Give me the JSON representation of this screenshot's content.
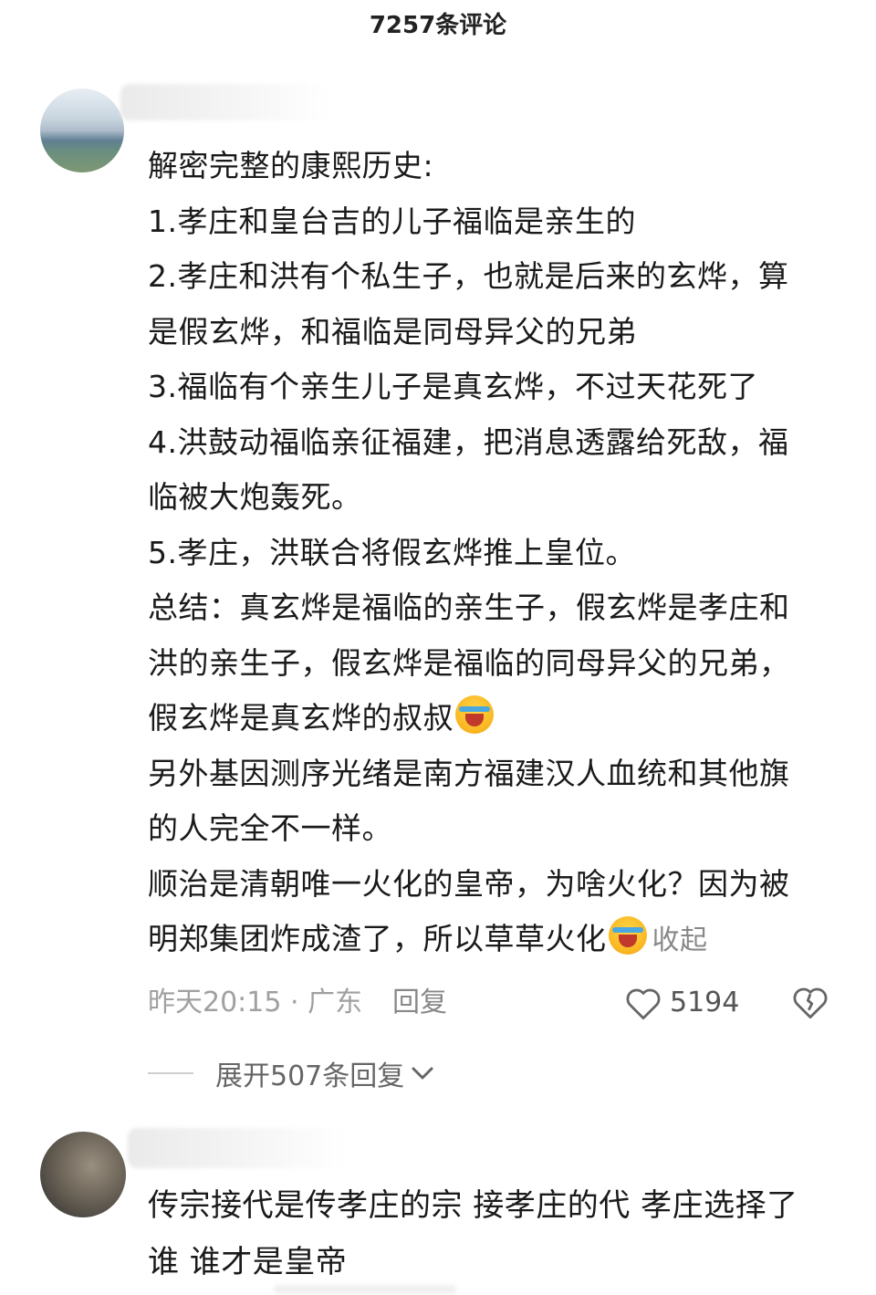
{
  "header": {
    "title": "7257条评论"
  },
  "comments": [
    {
      "lines": [
        "解密完整的康熙历史:",
        "1.孝庄和皇台吉的儿子福临是亲生的",
        "2.孝庄和洪有个私生子，也就是后来的玄烨，算",
        "是假玄烨，和福临是同母异父的兄弟",
        "3.福临有个亲生儿子是真玄烨，不过天花死了",
        "4.洪鼓动福临亲征福建，把消息透露给死敌，福",
        "临被大炮轰死。",
        "5.孝庄，洪联合将假玄烨推上皇位。",
        "总结：真玄烨是福临的亲生子，假玄烨是孝庄和",
        "洪的亲生子，假玄烨是福临的同母异父的兄弟，",
        "假玄烨是真玄烨的叔叔",
        "另外基因测序光绪是南方福建汉人血统和其他旗",
        "的人完全不一样。",
        "顺治是清朝唯一火化的皇帝，为啥火化？因为被",
        "明郑集团炸成渣了，所以草草火化"
      ],
      "collapse_label": "收起",
      "time_location": "昨天20:15 · 广东",
      "reply_label": "回复",
      "like_count": "5194",
      "expand_replies_label": "展开507条回复",
      "icons": {
        "like": "heart-outline-icon",
        "dislike": "broken-heart-icon",
        "expand": "chevron-down-icon",
        "emoji": "laugh-cry-emoji"
      }
    },
    {
      "lines": [
        "传宗接代是传孝庄的宗 接孝庄的代 孝庄选择了",
        "谁 谁才是皇帝"
      ]
    }
  ]
}
